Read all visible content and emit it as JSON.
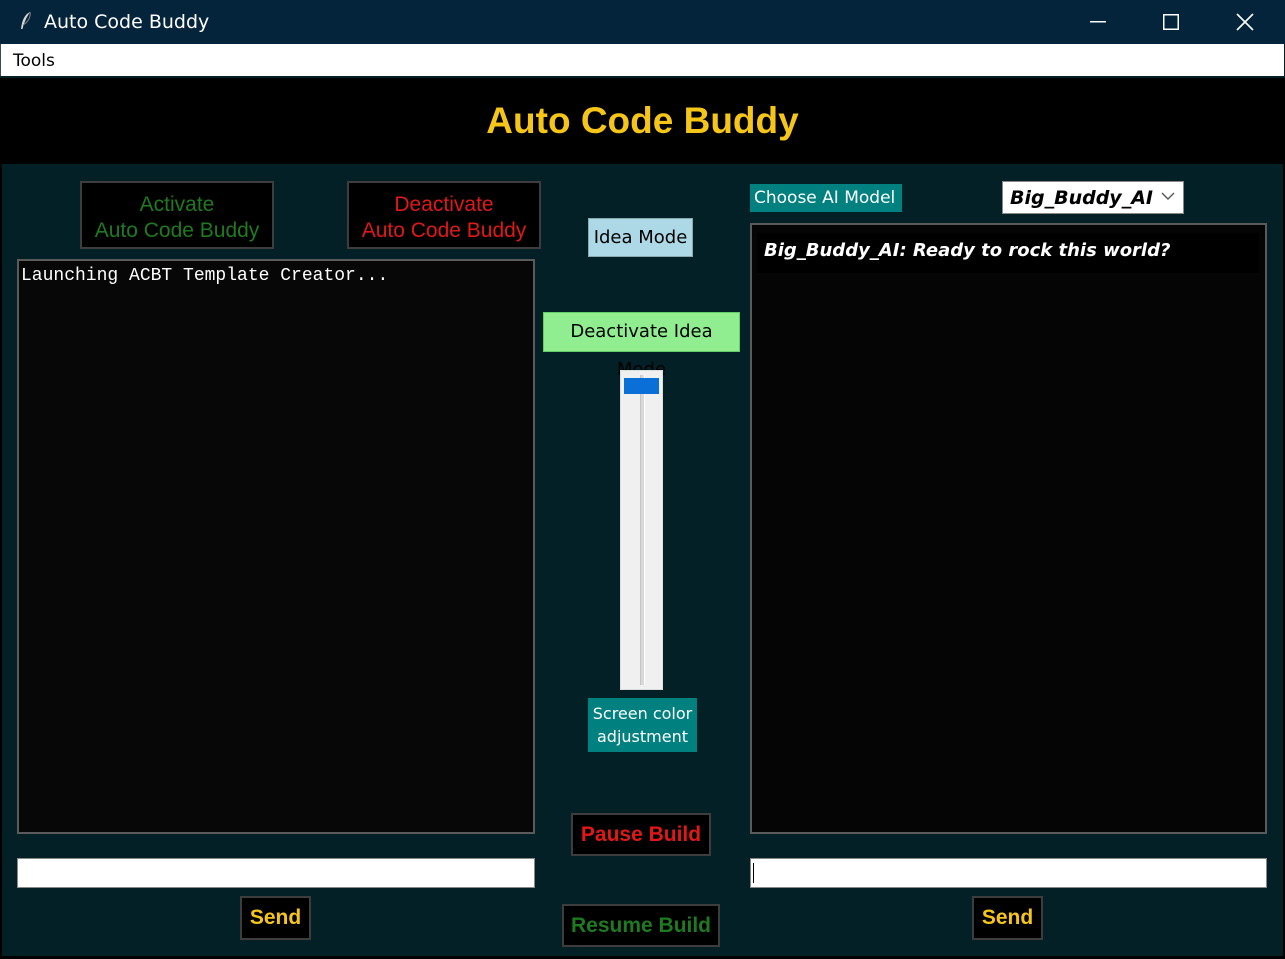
{
  "window": {
    "title": "Auto Code Buddy"
  },
  "menubar": {
    "tools_label": "Tools"
  },
  "header": {
    "title": "Auto Code Buddy"
  },
  "left_panel": {
    "activate_label_line1": "Activate",
    "activate_label_line2": "Auto Code Buddy",
    "deactivate_label_line1": "Deactivate",
    "deactivate_label_line2": "Auto Code Buddy",
    "console_text": "Launching ACBT Template Creator...",
    "input_value": "",
    "send_label": "Send"
  },
  "center_panel": {
    "idea_mode_label": "Idea Mode",
    "deactivate_idea_mode_label": "Deactivate Idea Mode",
    "screen_color_label_line1": "Screen color",
    "screen_color_label_line2": "adjustment",
    "screen_color_level": 0.0,
    "pause_build_label": "Pause Build",
    "resume_build_label": "Resume Build"
  },
  "right_panel": {
    "choose_model_label": "Choose AI Model",
    "selected_model": "Big_Buddy_AI",
    "chat_messages": [
      "Big_Buddy_AI: Ready to rock this world?"
    ],
    "input_value": "",
    "send_label": "Send"
  },
  "colors": {
    "accent_yellow": "#f5c518",
    "activate_green": "#1f7a1f",
    "deactivate_red": "#e01818",
    "teal_label": "#00807f",
    "background": "#022026",
    "title_bar": "#04243b"
  },
  "icons": {
    "app": "feather-icon",
    "minimize": "minimize-icon",
    "maximize": "maximize-icon",
    "close": "close-icon",
    "dropdown": "chevron-down-icon"
  }
}
